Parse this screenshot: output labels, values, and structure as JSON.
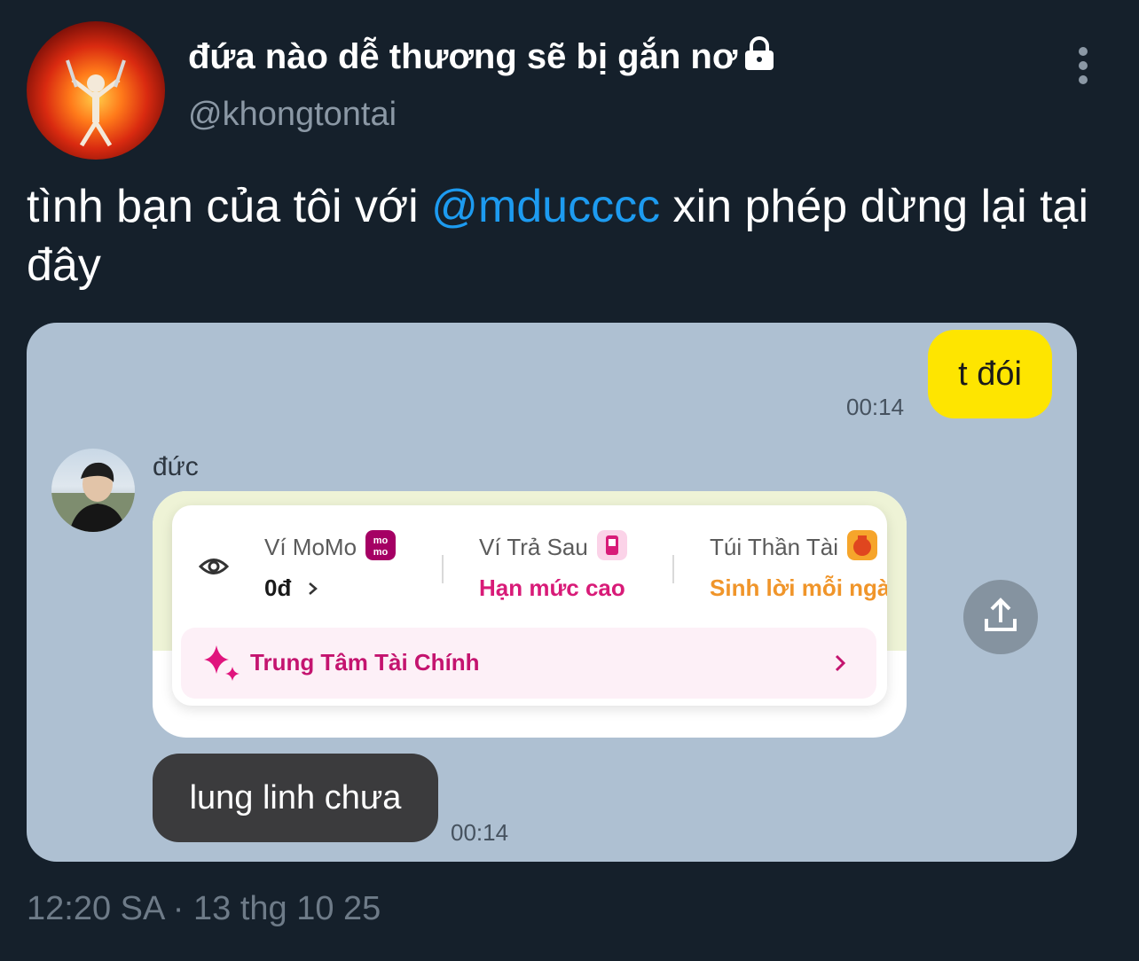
{
  "tweet": {
    "display_name": "đứa nào dễ thương sẽ bị gắn nơ",
    "handle": "@khongtontai",
    "text_before": "tình bạn của tôi với ",
    "mention": "@mducccc",
    "text_after": " xin phép dừng lại tại đây",
    "timestamp": "12:20 SA · 13 thg 10 25"
  },
  "chat": {
    "my_message": "t đói",
    "my_time": "00:14",
    "friend_name": "đức",
    "friend_message": "lung linh chưa",
    "friend_time": "00:14",
    "wallet": {
      "momo_label": "Ví MoMo",
      "momo_badge": "mo mo",
      "momo_value": "0đ",
      "paylater_label": "Ví Trả Sau",
      "paylater_value": "Hạn mức cao",
      "savings_label": "Túi Thần Tài",
      "savings_value": "Sinh lời mỗi ngà",
      "finance_center": "Trung Tâm Tài Chính"
    }
  },
  "colors": {
    "background": "#15202b",
    "mention": "#1d9bf0",
    "muted": "#8b98a5",
    "my_bubble": "#fee500",
    "friend_bubble": "#3b3b3d",
    "momo_pink": "#c4146f",
    "orange": "#f0952a"
  },
  "icons": [
    "lock-icon",
    "more-vertical-icon",
    "eye-icon",
    "chevron-right-icon",
    "sparkle-icon",
    "share-icon"
  ]
}
